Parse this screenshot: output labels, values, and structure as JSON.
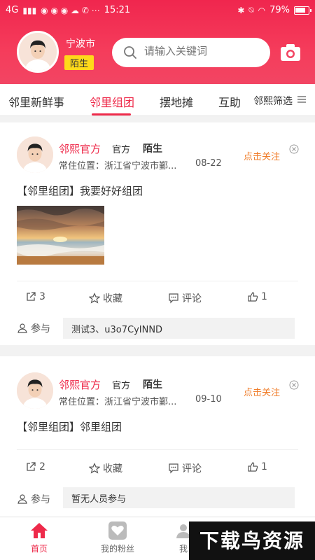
{
  "status_bar": {
    "network": "4G",
    "time": "15:21",
    "battery": "79%"
  },
  "header": {
    "city": "宁波市",
    "user_badge": "陌生",
    "search_placeholder": "请输入关键词"
  },
  "tabs": {
    "items": [
      "邻里新鲜事",
      "邻里组团",
      "摆地摊",
      "互助"
    ],
    "active": "邻里组团",
    "filter_label": "邻熙筛选"
  },
  "posts": [
    {
      "author": "邻熙官方",
      "tag": "官方",
      "status": "陌生",
      "location": "常住位置：浙江省宁波市鄞...",
      "date": "08-22",
      "follow": "点击关注",
      "content": "【邻里组团】我要好好组团",
      "has_image": true,
      "shares": "3",
      "collect": "收藏",
      "comment": "评论",
      "likes": "1",
      "join_label": "参与",
      "participants": "测试3、u3o7CyINND"
    },
    {
      "author": "邻熙官方",
      "tag": "官方",
      "status": "陌生",
      "location": "常住位置：浙江省宁波市鄞...",
      "date": "09-10",
      "follow": "点击关注",
      "content": "【邻里组团】邻里组团",
      "has_image": false,
      "shares": "2",
      "collect": "收藏",
      "comment": "评论",
      "likes": "1",
      "join_label": "参与",
      "participants": "暂无人员参与"
    }
  ],
  "bottom_nav": {
    "items": [
      "首页",
      "我的粉丝",
      "我"
    ],
    "active": "首页"
  },
  "watermark": "下载鸟资源",
  "colors": {
    "primary": "#ee2a4a",
    "follow": "#f07d2a",
    "badge": "#ffd91a"
  }
}
